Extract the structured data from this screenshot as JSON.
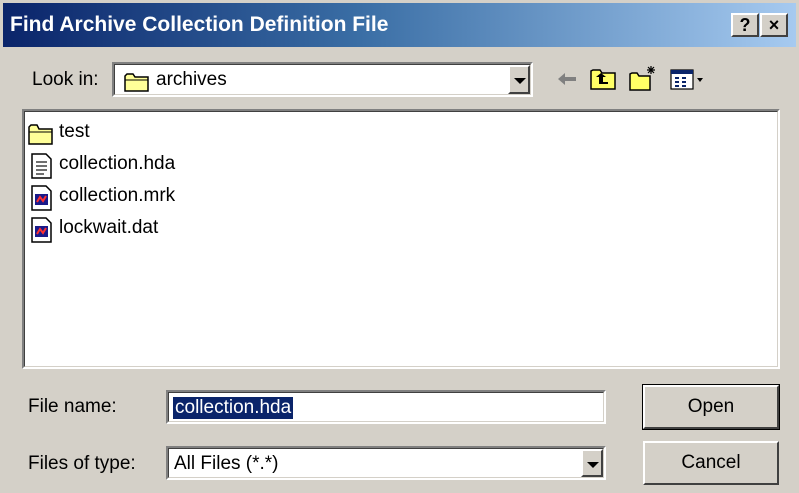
{
  "window": {
    "title": "Find Archive Collection Definition File",
    "help_label": "?",
    "close_label": "×"
  },
  "lookin": {
    "label": "Look in:",
    "value": "archives"
  },
  "toolbar": {
    "icons": [
      "back-arrow-icon",
      "up-one-level-icon",
      "new-folder-icon",
      "view-menu-icon"
    ]
  },
  "files": [
    {
      "name": "test",
      "icon": "folder-icon"
    },
    {
      "name": "collection.hda",
      "icon": "text-file-icon"
    },
    {
      "name": "collection.mrk",
      "icon": "data-file-icon"
    },
    {
      "name": "lockwait.dat",
      "icon": "data-file-icon"
    }
  ],
  "filename": {
    "label": "File name:",
    "value": "collection.hda"
  },
  "filetype": {
    "label": "Files of type:",
    "value": "All Files (*.*)"
  },
  "buttons": {
    "open": "Open",
    "cancel": "Cancel"
  }
}
